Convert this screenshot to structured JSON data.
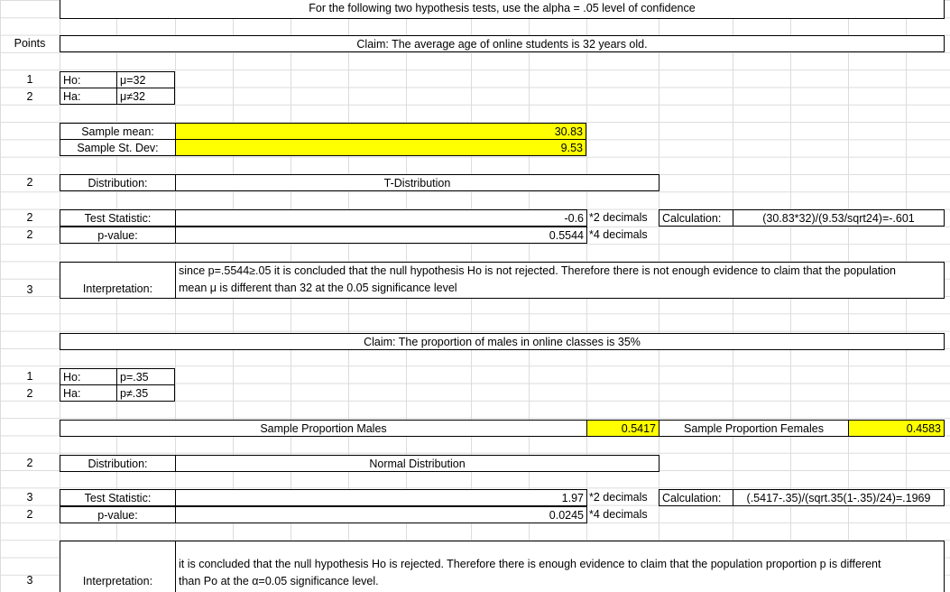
{
  "header": "For the following two hypothesis tests, use the alpha = .05 level of confidence",
  "points_header": "Points",
  "test1": {
    "claim": "Claim: The average age of online students is 32 years old.",
    "pts_ho": "1",
    "pts_ha": "2",
    "ho_label": "Ho:",
    "ho_value": "μ=32",
    "ha_label": "Ha:",
    "ha_value": "μ≠32",
    "sample_mean_label": "Sample mean:",
    "sample_mean_value": "30.83",
    "sample_sd_label": "Sample St. Dev:",
    "sample_sd_value": "9.53",
    "pts_dist": "2",
    "dist_label": "Distribution:",
    "dist_value": "T-Distribution",
    "pts_ts": "2",
    "pts_pv": "2",
    "ts_label": "Test Statistic:",
    "ts_value": "-0.6",
    "ts_note": "*2 decimals",
    "calc_label": "Calculation:",
    "calc_value": "(30.83*32)/(9.53/sqrt24)=-.601",
    "pv_label": "p-value:",
    "pv_value": "0.5544",
    "pv_note": "*4 decimals",
    "pts_interp": "3",
    "interp_label": "Interpretation:",
    "interp_line1": "since p=.5544≥.05 it is concluded that the null hypothesis Ho is not rejected. Therefore there is not enough evidence to claim that the population",
    "interp_line2": "mean μ is different than 32 at the 0.05 significance level"
  },
  "test2": {
    "claim": "Claim: The proportion of males in online classes is 35%",
    "pts_ho": "1",
    "pts_ha": "2",
    "ho_label": "Ho:",
    "ho_value": "p=.35",
    "ha_label": "Ha:",
    "ha_value": "p≠.35",
    "males_label": "Sample Proportion Males",
    "males_value": "0.5417",
    "females_label": "Sample Proportion Females",
    "females_value": "0.4583",
    "pts_dist": "2",
    "dist_label": "Distribution:",
    "dist_value": "Normal Distribution",
    "pts_ts": "3",
    "pts_pv": "2",
    "ts_label": "Test Statistic:",
    "ts_value": "1.97",
    "ts_note": "*2 decimals",
    "calc_label": "Calculation:",
    "calc_value": "(.5417-.35)/(sqrt.35(1-.35)/24)=.1969",
    "pv_label": "p-value:",
    "pv_value": "0.0245",
    "pv_note": "*4 decimals",
    "pts_interp": "3",
    "interp_label": "Interpretation:",
    "interp_line1": "it is concluded that the null hypothesis Ho is rejected. Therefore there is enough evidence to claim that the population proportion p is different",
    "interp_line2": "than Po at the α=0.05 significance level."
  }
}
